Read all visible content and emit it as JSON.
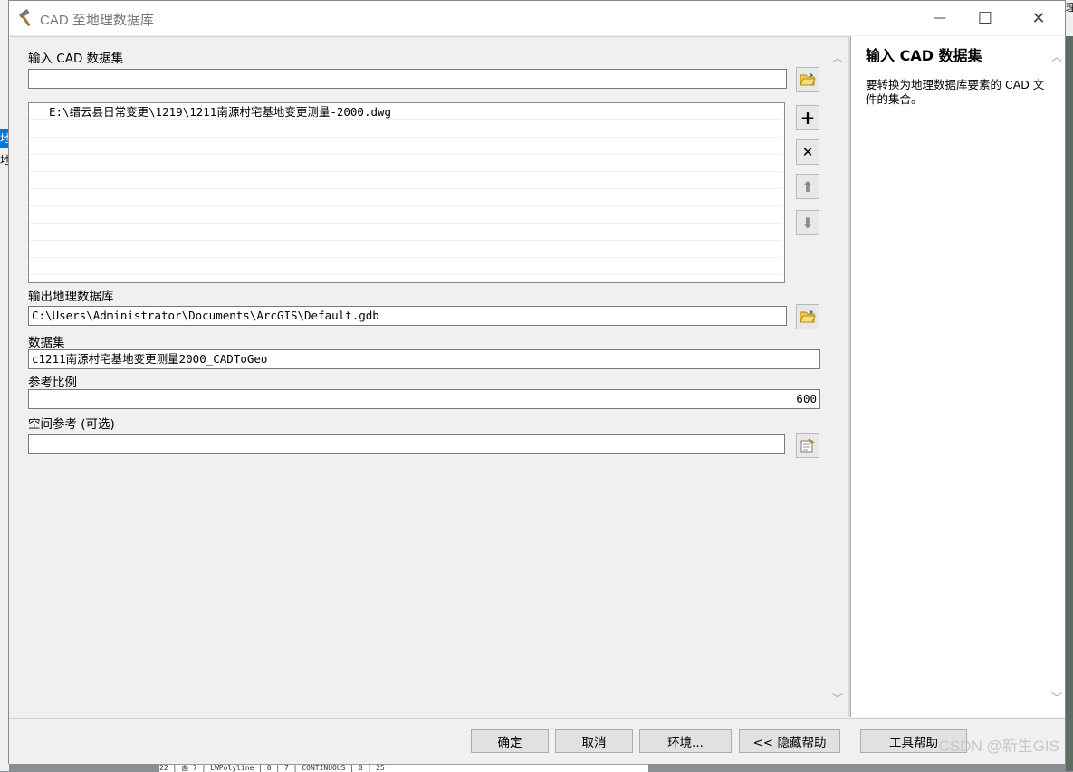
{
  "window": {
    "title": "CAD 至地理数据库",
    "icon": "hammer-icon",
    "minimize_glyph": "—",
    "maximize_glyph": "☐",
    "close_glyph": "✕"
  },
  "background": {
    "left_fragment_1": "地",
    "left_fragment_2": "地",
    "right_fragment": "理",
    "table_fragment": "22 | 面 7 | LWPolyline | 0 | 7 | CONTINUOUS | 0 | 25"
  },
  "form": {
    "input_cad_label": "输入 CAD 数据集",
    "input_cad_value": "",
    "cad_list": [
      "E:\\缙云县日常变更\\1219\\1211南源村宅基地变更测量-2000.dwg",
      "",
      "",
      "",
      "",
      "",
      "",
      "",
      "",
      "",
      ""
    ],
    "list_buttons": {
      "add": "+",
      "remove": "✕",
      "up": "⬆",
      "down": "⬇"
    },
    "output_gdb_label": "输出地理数据库",
    "output_gdb_value": "C:\\Users\\Administrator\\Documents\\ArcGIS\\Default.gdb",
    "dataset_label": "数据集",
    "dataset_value": "c1211南源村宅基地变更测量2000_CADToGeo",
    "scale_label": "参考比例",
    "scale_value": "600",
    "spatial_ref_label": "空间参考 (可选)",
    "spatial_ref_value": ""
  },
  "help": {
    "title": "输入 CAD 数据集",
    "text": "要转换为地理数据库要素的 CAD 文件的集合。"
  },
  "buttons": {
    "ok": "确定",
    "cancel": "取消",
    "env": "环境...",
    "hide_help": "<< 隐藏帮助",
    "tool_help": "工具帮助"
  },
  "watermark": "CSDN @新生GIS"
}
